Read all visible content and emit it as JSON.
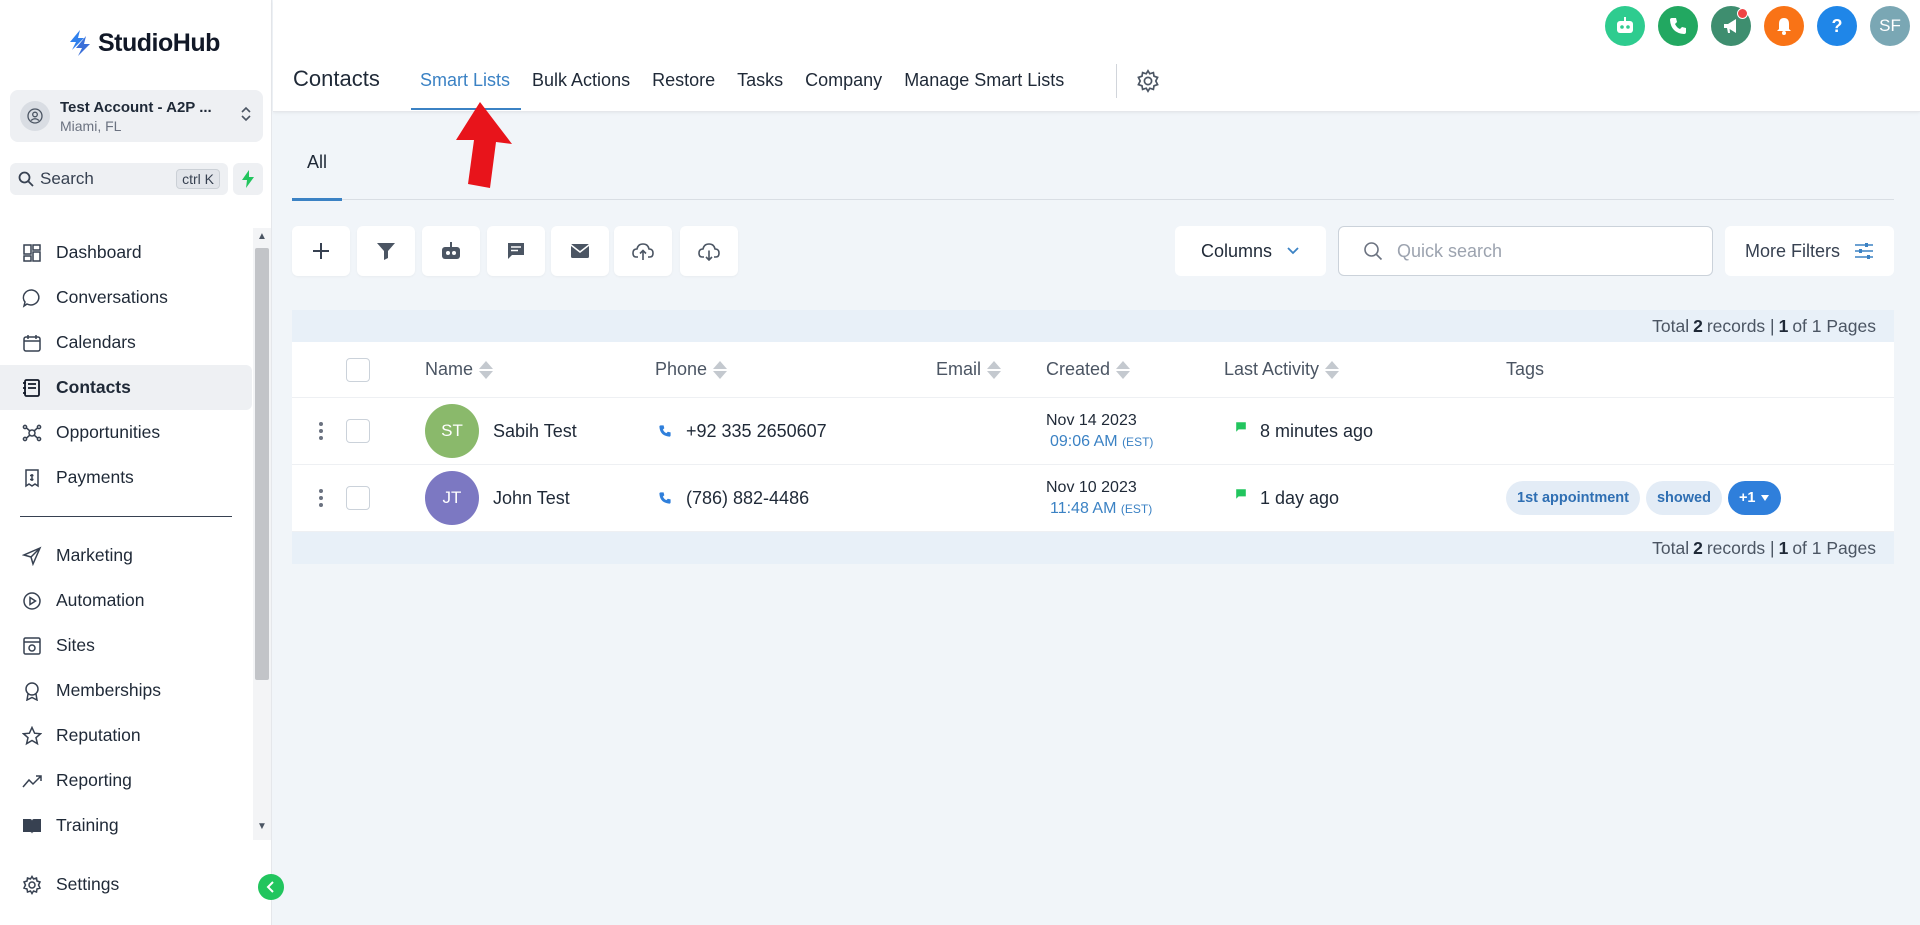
{
  "brand": {
    "name": "StudioHub"
  },
  "account": {
    "name": "Test Account - A2P ...",
    "location": "Miami, FL"
  },
  "search": {
    "label": "Search",
    "shortcut": "ctrl K"
  },
  "sidebar": {
    "items": [
      {
        "label": "Dashboard",
        "icon": "grid-icon"
      },
      {
        "label": "Conversations",
        "icon": "chat-bubble-icon"
      },
      {
        "label": "Calendars",
        "icon": "calendar-icon"
      },
      {
        "label": "Contacts",
        "icon": "contacts-book-icon",
        "active": true
      },
      {
        "label": "Opportunities",
        "icon": "opportunities-icon"
      },
      {
        "label": "Payments",
        "icon": "receipt-icon"
      }
    ],
    "items2": [
      {
        "label": "Marketing",
        "icon": "send-icon"
      },
      {
        "label": "Automation",
        "icon": "automation-icon"
      },
      {
        "label": "Sites",
        "icon": "sites-icon"
      },
      {
        "label": "Memberships",
        "icon": "award-icon"
      },
      {
        "label": "Reputation",
        "icon": "star-icon"
      },
      {
        "label": "Reporting",
        "icon": "trend-icon"
      },
      {
        "label": "Training",
        "icon": "book-icon"
      }
    ],
    "settings_label": "Settings"
  },
  "header": {
    "title": "Contacts",
    "tabs": [
      "Smart Lists",
      "Bulk Actions",
      "Restore",
      "Tasks",
      "Company",
      "Manage Smart Lists"
    ],
    "active_tab": "Smart Lists",
    "user_initials": "SF",
    "help_label": "?"
  },
  "content": {
    "subtab": "All",
    "columns_label": "Columns",
    "quick_search_placeholder": "Quick search",
    "more_filters_label": "More Filters"
  },
  "summary": {
    "prefix": "Total",
    "records": "2",
    "records_label": "records |",
    "page": "1",
    "of_label": "of 1 Pages"
  },
  "table": {
    "headers": {
      "name": "Name",
      "phone": "Phone",
      "email": "Email",
      "created": "Created",
      "last_activity": "Last Activity",
      "tags": "Tags"
    },
    "rows": [
      {
        "initials": "ST",
        "avatar_color": "#8ab96b",
        "name": "Sabih Test",
        "phone": "+92 335 2650607",
        "email": "",
        "created_date": "Nov 14 2023",
        "created_time": "09:06 AM",
        "tz": "(EST)",
        "last_activity": "8 minutes ago",
        "tags": []
      },
      {
        "initials": "JT",
        "avatar_color": "#7c78c2",
        "name": "John Test",
        "phone": "(786) 882-4486",
        "email": "",
        "created_date": "Nov 10 2023",
        "created_time": "11:48 AM",
        "tz": "(EST)",
        "last_activity": "1 day ago",
        "tags": [
          "1st appointment",
          "showed"
        ],
        "more_tags": "+1"
      }
    ]
  },
  "colors": {
    "accent": "#3b82c4",
    "annotation_arrow": "#e8141b"
  }
}
